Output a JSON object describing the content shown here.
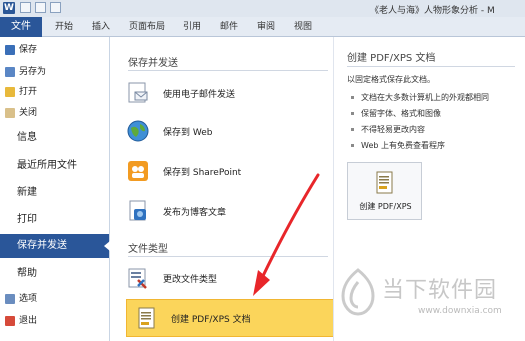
{
  "window": {
    "title": "《老人与海》人物形象分析 - M",
    "app_icon": "W"
  },
  "ribbon": {
    "file_tab": "文件",
    "tabs": [
      "开始",
      "插入",
      "页面布局",
      "引用",
      "邮件",
      "审阅",
      "视图"
    ]
  },
  "leftnav": {
    "small_top": [
      {
        "label": "保存",
        "icon": "save-icon"
      },
      {
        "label": "另存为",
        "icon": "save-as-icon"
      },
      {
        "label": "打开",
        "icon": "open-folder-icon"
      },
      {
        "label": "关闭",
        "icon": "close-doc-icon"
      }
    ],
    "big": [
      "信息",
      "最近所用文件",
      "新建",
      "打印",
      "保存并发送",
      "帮助"
    ],
    "active": "保存并发送",
    "small_bottom": [
      {
        "label": "选项",
        "icon": "options-icon"
      },
      {
        "label": "退出",
        "icon": "exit-icon"
      }
    ]
  },
  "middle": {
    "section1_title": "保存并发送",
    "send_options": [
      {
        "label": "使用电子邮件发送",
        "icon": "email-icon"
      },
      {
        "label": "保存到 Web",
        "icon": "web-globe-icon"
      },
      {
        "label": "保存到 SharePoint",
        "icon": "sharepoint-icon"
      },
      {
        "label": "发布为博客文章",
        "icon": "blog-icon"
      }
    ],
    "section2_title": "文件类型",
    "file_type_options": [
      {
        "label": "更改文件类型",
        "icon": "change-type-icon"
      },
      {
        "label": "创建 PDF/XPS 文档",
        "icon": "pdf-doc-icon",
        "selected": true
      }
    ]
  },
  "right": {
    "title": "创建 PDF/XPS 文档",
    "description": "以固定格式保存此文档。",
    "bullets": [
      "文档在大多数计算机上的外观都相同",
      "保留字体、格式和图像",
      "不得轻易更改内容",
      "Web 上有免费查看程序"
    ],
    "button_label": "创建 PDF/XPS"
  },
  "watermark": {
    "brand": "当下软件园",
    "url": "www.downxia.com"
  },
  "colors": {
    "accent": "#2a5699",
    "selected": "#fbd55b",
    "arrow": "#e8262a"
  }
}
